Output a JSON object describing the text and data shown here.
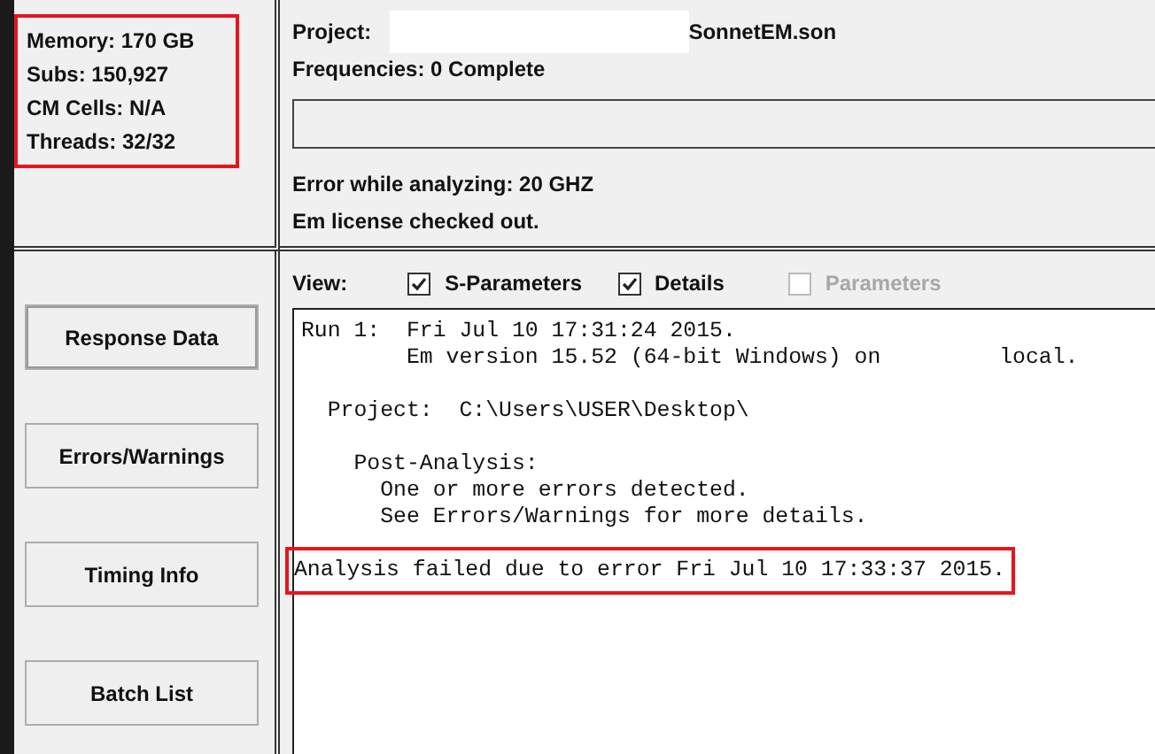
{
  "stats": {
    "highlighted": true,
    "lines": [
      "Memory: 170 GB",
      "Subs: 150,927",
      "CM Cells: N/A",
      "Threads: 32/32"
    ]
  },
  "project": {
    "label": "Project:",
    "file": "SonnetEM.son"
  },
  "frequencies": "Frequencies:  0 Complete",
  "status_lines": [
    "Error while analyzing:  20 GHZ",
    "Em license checked out."
  ],
  "buttons": [
    "Response Data",
    "Errors/Warnings",
    "Timing Info",
    "Batch List"
  ],
  "view": {
    "label": "View:",
    "options": [
      {
        "label": "S-Parameters",
        "checked": true,
        "disabled": false
      },
      {
        "label": "Details",
        "checked": true,
        "disabled": false
      },
      {
        "label": "Parameters",
        "checked": false,
        "disabled": true
      }
    ]
  },
  "log": [
    {
      "lines": [
        "Run 1:  Fri Jul 10 17:31:24 2015.",
        "        Em version 15.52 (64-bit Windows) on         local."
      ],
      "highlighted": false
    },
    {
      "lines": [
        "  Project:  C:\\Users\\USER\\Desktop\\"
      ],
      "highlighted": false
    },
    {
      "lines": [
        "    Post-Analysis:",
        "      One or more errors detected.",
        "      See Errors/Warnings for more details."
      ],
      "highlighted": false
    },
    {
      "lines": [
        "Analysis failed due to error Fri Jul 10 17:33:37 2015."
      ],
      "highlighted": true
    }
  ]
}
